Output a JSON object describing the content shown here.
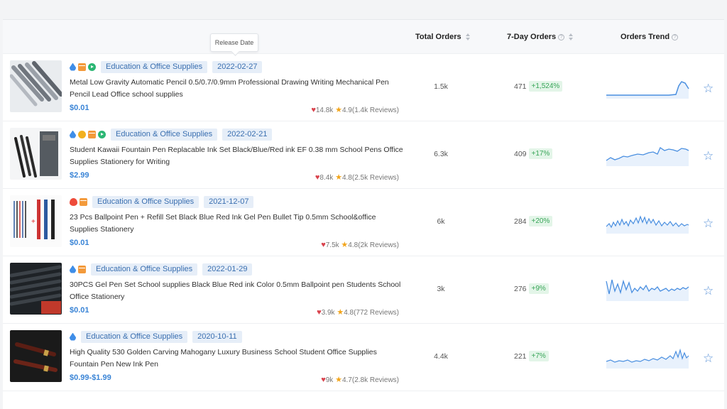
{
  "header": {
    "total_orders": "Total Orders",
    "seven_day_orders": "7-Day Orders",
    "orders_trend": "Orders Trend",
    "tooltip": "Release Date"
  },
  "rows": [
    {
      "category": "Education & Office Supplies",
      "date": "2022-02-27",
      "title": "Metal Low Gravity Automatic Pencil 0.5/0.7/0.9mm Professional Drawing Writing Mechanical Pen Pencil Lead Office school supplies",
      "price": "$0.01",
      "likes": "14.8k",
      "rating": "4.9(1.4k Reviews)",
      "total_orders": "1.5k",
      "seven_day": "471",
      "pct": "+1,524%",
      "icons": [
        "drop-icon",
        "box-icon",
        "play-icon"
      ]
    },
    {
      "category": "Education & Office Supplies",
      "date": "2022-02-21",
      "title": "Student Kawaii Fountain Pen Replacable Ink Set Black/Blue/Red ink EF 0.38 mm School Pens Office Supplies Stationery for Writing",
      "price": "$2.99",
      "likes": "8.4k",
      "rating": "4.8(2.5k Reviews)",
      "total_orders": "6.3k",
      "seven_day": "409",
      "pct": "+17%",
      "icons": [
        "drop-icon",
        "medal-icon",
        "box-icon",
        "play-icon"
      ]
    },
    {
      "category": "Education & Office Supplies",
      "date": "2021-12-07",
      "title": "23 Pcs Ballpoint Pen + Refill Set Black Blue Red Ink Gel Pen Bullet Tip 0.5mm School&office Supplies Stationery",
      "price": "$0.01",
      "likes": "7.5k",
      "rating": "4.8(2k Reviews)",
      "total_orders": "6k",
      "seven_day": "284",
      "pct": "+20%",
      "icons": [
        "flame-icon",
        "box-icon"
      ]
    },
    {
      "category": "Education & Office Supplies",
      "date": "2022-01-29",
      "title": "30PCS Gel Pen Set School supplies Black Blue Red ink Color 0.5mm Ballpoint pen Students School Office Stationery",
      "price": "$0.01",
      "likes": "3.9k",
      "rating": "4.8(772 Reviews)",
      "total_orders": "3k",
      "seven_day": "276",
      "pct": "+9%",
      "icons": [
        "drop-icon",
        "box-icon"
      ]
    },
    {
      "category": "Education & Office Supplies",
      "date": "2020-10-11",
      "title": "High Quality 530 Golden Carving Mahogany Luxury Business School Student Office Supplies Fountain Pen New Ink Pen",
      "price": "$0.99-$1.99",
      "likes": "9k",
      "rating": "4.7(2.8k Reviews)",
      "total_orders": "4.4k",
      "seven_day": "221",
      "pct": "+7%",
      "icons": [
        "drop-icon"
      ]
    }
  ],
  "colors": {
    "accent": "#3a84d6",
    "tag_bg": "#e6eef8",
    "pct_bg": "#e3f5e8",
    "pct_text": "#38a558",
    "trend_line": "#4a8fe0"
  }
}
